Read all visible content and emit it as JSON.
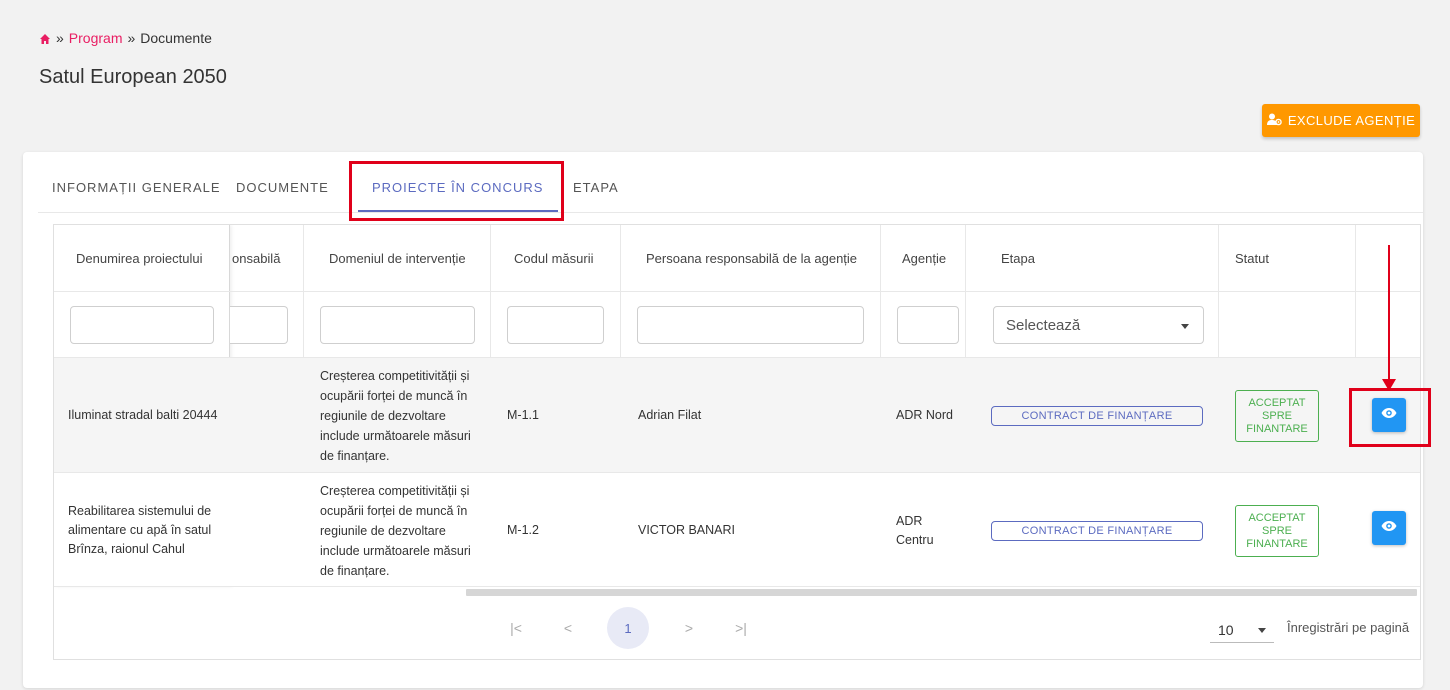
{
  "breadcrumb": {
    "sep1": "»",
    "link": "Program",
    "sep2": "»",
    "current": "Documente"
  },
  "page": {
    "title": "Satul European 2050",
    "exclude_button": "EXCLUDE AGENȚIE"
  },
  "tabs": [
    {
      "label": "INFORMAȚII GENERALE"
    },
    {
      "label": "DOCUMENTE"
    },
    {
      "label": "PROIECTE ÎN CONCURS"
    },
    {
      "label": "ETAPA"
    }
  ],
  "table": {
    "headers": {
      "name": "Denumirea proiectului",
      "responsible": "onsabilă",
      "domain": "Domeniul de intervenție",
      "code": "Codul măsurii",
      "person": "Persoana responsabilă de la agenție",
      "agency": "Agenție",
      "stage": "Etapa",
      "status": "Statut"
    },
    "filter_select_placeholder": "Selectează",
    "rows": [
      {
        "name": "Iluminat stradal balti 20444",
        "domain": "Creșterea competitivității și ocupării forței de muncă în regiunile de dezvoltare include următoarele măsuri de finanțare.",
        "code": "M-1.1",
        "person": "Adrian Filat",
        "agency": "ADR Nord",
        "stage": "CONTRACT DE FINANȚARE",
        "status": "ACCEPTAT SPRE FINANTARE"
      },
      {
        "name": "Reabilitarea sistemului de alimentare cu apă în satul Brînza, raionul Cahul",
        "domain": "Creșterea competitivității și ocupării forței de muncă în regiunile de dezvoltare include următoarele măsuri de finanțare.",
        "code": "M-1.2",
        "person": "VICTOR BANARI",
        "agency": "ADR Centru",
        "stage": "CONTRACT DE FINANȚARE",
        "status": "ACCEPTAT SPRE FINANTARE"
      }
    ]
  },
  "pagination": {
    "first": "|<",
    "prev": "<",
    "page": "1",
    "next": ">",
    "last": ">|",
    "per_page": "10",
    "per_page_label": "Înregistrări pe pagină"
  },
  "colors": {
    "accent": "#5c6bc0",
    "link": "#e91e63",
    "orange": "#ff9800",
    "success": "#4caf50",
    "info": "#2196f3",
    "annotation": "#e0001a"
  }
}
